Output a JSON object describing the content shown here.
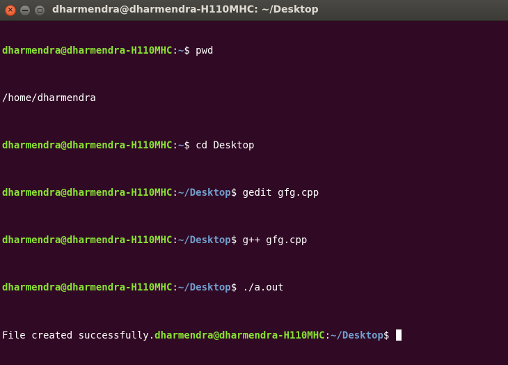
{
  "window": {
    "title": "dharmendra@dharmendra-H110MHC: ~/Desktop",
    "buttons": {
      "close": "×"
    }
  },
  "terminal": {
    "lines": [
      {
        "user": "dharmendra@dharmendra-H110MHC",
        "sep": ":",
        "path": "~",
        "prompt": "$ ",
        "command": "pwd"
      },
      {
        "output": "/home/dharmendra"
      },
      {
        "user": "dharmendra@dharmendra-H110MHC",
        "sep": ":",
        "path": "~",
        "prompt": "$ ",
        "command": "cd Desktop"
      },
      {
        "user": "dharmendra@dharmendra-H110MHC",
        "sep": ":",
        "path": "~/Desktop",
        "prompt": "$ ",
        "command": "gedit gfg.cpp"
      },
      {
        "user": "dharmendra@dharmendra-H110MHC",
        "sep": ":",
        "path": "~/Desktop",
        "prompt": "$ ",
        "command": "g++ gfg.cpp"
      },
      {
        "user": "dharmendra@dharmendra-H110MHC",
        "sep": ":",
        "path": "~/Desktop",
        "prompt": "$ ",
        "command": "./a.out"
      },
      {
        "output": "File created successfully.",
        "user": "dharmendra@dharmendra-H110MHC",
        "sep": ":",
        "path": "~/Desktop",
        "prompt": "$ ",
        "command": ""
      }
    ]
  },
  "colors": {
    "background": "#300a24",
    "user": "#8ae234",
    "path": "#729fcf",
    "text": "#ffffff",
    "titlebar": "#3c3b37",
    "close_button": "#e4491c"
  }
}
